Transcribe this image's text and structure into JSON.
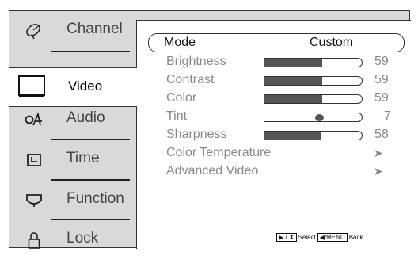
{
  "sidebar": {
    "items": [
      {
        "label": "Channel",
        "icon": "satellite-dish-icon"
      },
      {
        "label": "Video",
        "icon": "monitor-icon"
      },
      {
        "label": "Audio",
        "icon": "audio-icon"
      },
      {
        "label": "Time",
        "icon": "clock-icon"
      },
      {
        "label": "Function",
        "icon": "function-icon"
      },
      {
        "label": "Lock",
        "icon": "padlock-icon"
      }
    ],
    "active": "Video"
  },
  "panel": {
    "mode": {
      "label": "Mode",
      "value": "Custom"
    },
    "settings": [
      {
        "label": "Brightness",
        "value": "59",
        "level": 0.59
      },
      {
        "label": "Contrast",
        "value": "59",
        "level": 0.59
      },
      {
        "label": "Color",
        "value": "59",
        "level": 0.59
      },
      {
        "label": "Tint",
        "value": "7",
        "level": 0.57
      },
      {
        "label": "Sharpness",
        "value": "58",
        "level": 0.58
      }
    ],
    "submenus": [
      {
        "label": "Color Temperature",
        "arrow": "➤"
      },
      {
        "label": "Advanced Video",
        "arrow": "➤"
      }
    ],
    "hint": {
      "nav_key": "▶ / ⬍",
      "select": "Select",
      "back_key": "◀/MENU",
      "back": "Back"
    }
  },
  "colors": {
    "background": "#d9d9d9",
    "panel": "#ffffff",
    "bar_fill": "#555555",
    "text_dim": "#888888"
  }
}
